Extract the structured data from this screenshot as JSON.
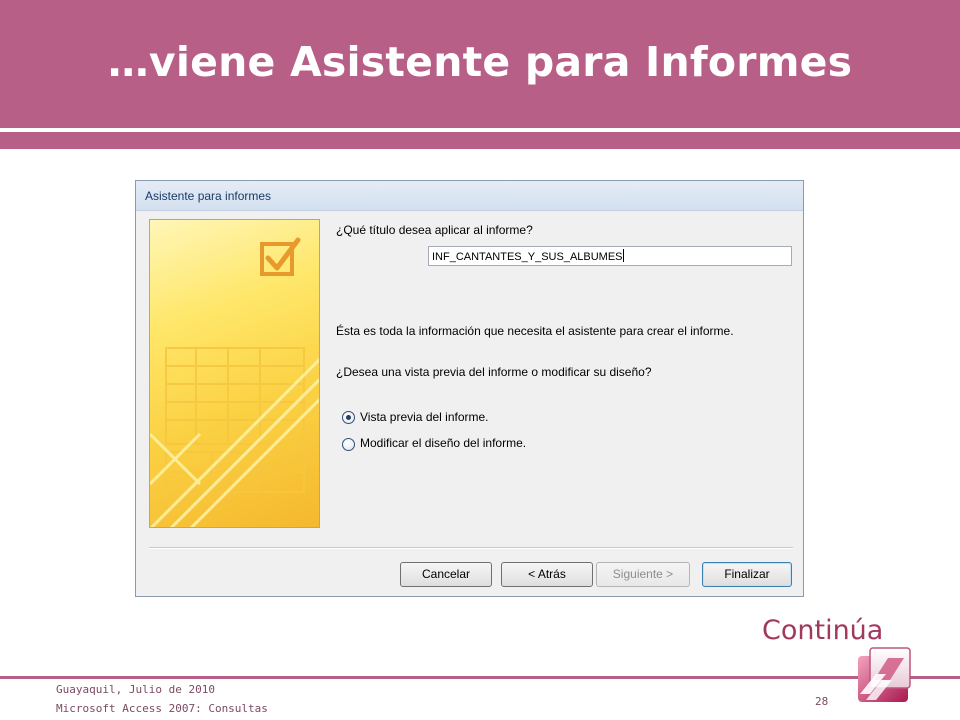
{
  "slide": {
    "title": "…viene Asistente para Informes",
    "continue_label": "Continúa",
    "footer_line1": "Guayaquil, Julio de 2010",
    "footer_line2": "Microsoft Access 2007: Consultas",
    "page_number": "28"
  },
  "dialog": {
    "title": "Asistente para informes",
    "title_question": "¿Qué título desea aplicar al informe?",
    "title_value": "INF_CANTANTES_Y_SUS_ALBUMES",
    "info_text": "Ésta es toda la información que necesita el asistente para crear el informe.",
    "preview_question": "¿Desea una vista previa del informe o modificar su diseño?",
    "options": [
      {
        "label": "Vista previa del informe.",
        "selected": true
      },
      {
        "label": "Modificar el diseño del informe.",
        "selected": false
      }
    ],
    "buttons": {
      "cancel": "Cancelar",
      "back": "< Atrás",
      "next": "Siguiente >",
      "finish": "Finalizar"
    }
  },
  "colors": {
    "slide_accent": "#b85f87",
    "continue_text": "#a1395f",
    "wizard_art": "#fbd244"
  },
  "icons": {
    "wizard_art": "checkbox-report-icon",
    "logo": "microsoft-access-logo-icon"
  }
}
